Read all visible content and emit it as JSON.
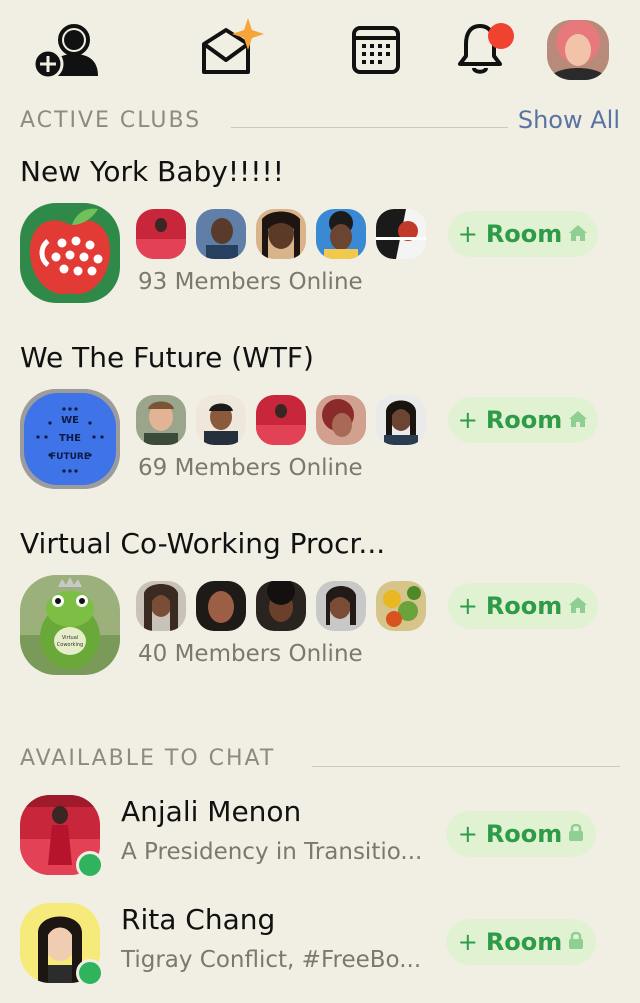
{
  "topbar": {
    "icons": [
      "add-person-icon",
      "invite-envelope-icon",
      "calendar-icon",
      "notification-bell-icon",
      "profile-avatar"
    ],
    "notification_badge_color": "#f0432f"
  },
  "active_clubs": {
    "title": "ACTIVE CLUBS",
    "show_all_label": "Show All",
    "clubs": [
      {
        "name": "New York Baby!!!!!",
        "members_online": "93 Members Online",
        "room_plus": "+",
        "room_label": "Room",
        "room_icon": "house-icon"
      },
      {
        "name": "We The Future (WTF)",
        "logo_text_top": "WE",
        "logo_text_mid": "THE",
        "logo_text_bottom": "FUTURE",
        "members_online": "69 Members Online",
        "room_plus": "+",
        "room_label": "Room",
        "room_icon": "house-icon"
      },
      {
        "name": "Virtual Co-Working Procr...",
        "logo_text_top": "Virtual",
        "logo_text_bottom": "Coworking",
        "members_online": "40 Members Online",
        "room_plus": "+",
        "room_label": "Room",
        "room_icon": "house-icon"
      }
    ]
  },
  "available_to_chat": {
    "title": "AVAILABLE TO CHAT",
    "people": [
      {
        "name": "Anjali Menon",
        "status": "A Presidency in Transitio...",
        "room_plus": "+",
        "room_label": "Room",
        "room_icon": "lock-icon",
        "online": true
      },
      {
        "name": "Rita Chang",
        "status": "Tigray Conflict, #FreeBo...",
        "room_plus": "+",
        "room_label": "Room",
        "room_icon": "lock-icon",
        "online": true
      }
    ]
  },
  "colors": {
    "background": "#f1efe4",
    "room_button_bg": "#e1f2d2",
    "room_button_text": "#2e9b48",
    "show_all": "#5a73a3",
    "online": "#2fb35c"
  }
}
